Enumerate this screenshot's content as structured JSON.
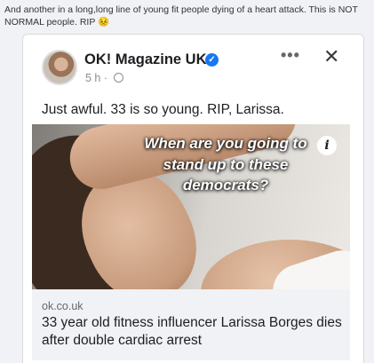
{
  "share_caption": "And another in a long,long line of young fit people dying of a heart attack. This is NOT NORMAL people. RIP 😣",
  "post": {
    "page_name": "OK! Magazine UK",
    "verified_mark": "✓",
    "time_meta": "5 h ·",
    "more_label": "•••",
    "close_label": "✕",
    "text": "Just awful. 33 is so young. RIP, Larissa.",
    "image_overlay_text": "When are you going to stand up to these democrats?",
    "info_label": "i",
    "link": {
      "domain": "ok.co.uk",
      "headline": "33 year old fitness influencer Larissa Borges dies after double cardiac arrest"
    }
  },
  "icons": {
    "verified": "verified-badge-icon",
    "globe": "globe-icon",
    "more": "more-options-icon",
    "close": "close-icon",
    "info": "info-icon"
  },
  "colors": {
    "verified_blue": "#1877f2",
    "link_box_bg": "#f0f2f5",
    "meta_gray": "#8a8d91"
  }
}
